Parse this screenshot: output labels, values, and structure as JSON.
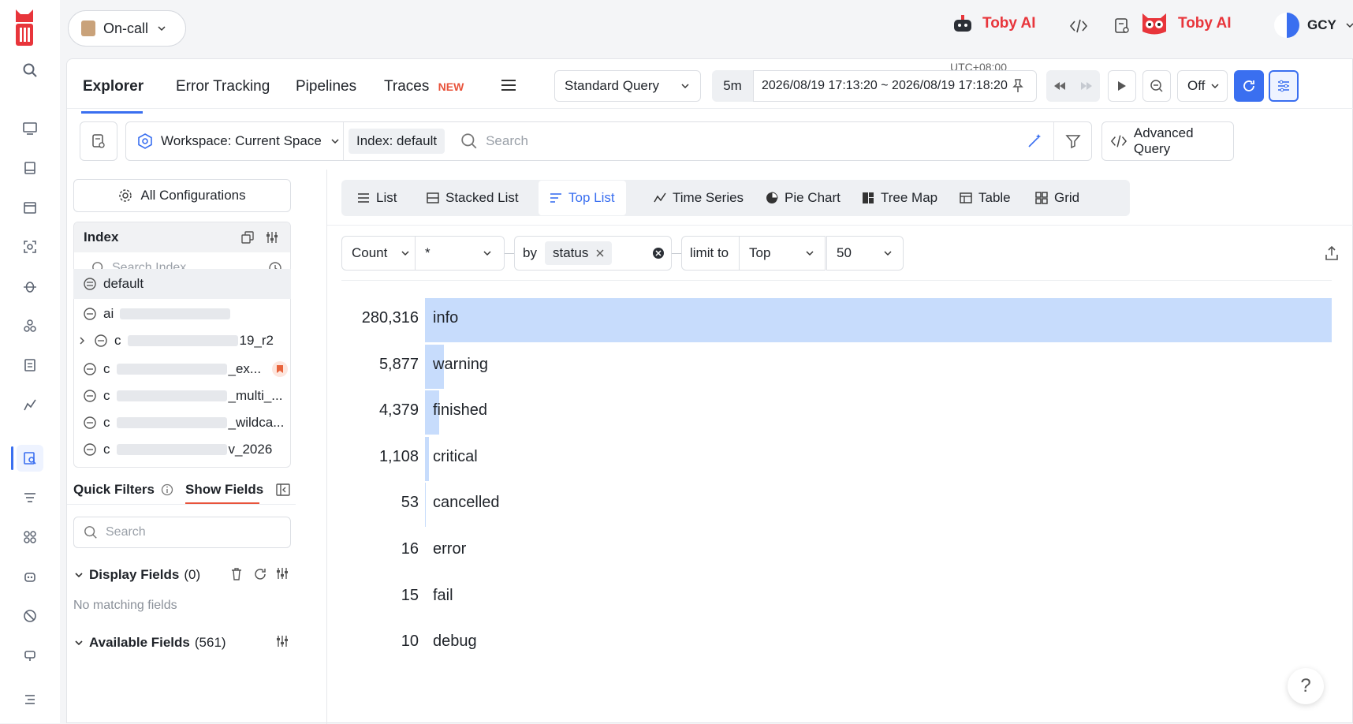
{
  "topbar": {
    "oncall_label": "On-call",
    "toby_ai_1": "Toby AI",
    "toby_ai_2": "Toby AI",
    "user_initials": "GCY"
  },
  "nav": {
    "tabs": [
      {
        "label": "Explorer",
        "active": true
      },
      {
        "label": "Error Tracking",
        "active": false
      },
      {
        "label": "Pipelines",
        "active": false
      },
      {
        "label": "Traces",
        "active": false
      }
    ],
    "traces_badge": "NEW",
    "query_mode": "Standard Query",
    "timezone": "UTC+08:00",
    "time_preset": "5m",
    "time_range": "2026/08/19 17:13:20 ~ 2026/08/19 17:18:20",
    "refresh_mode": "Off"
  },
  "searchbar": {
    "workspace": "Workspace: Current Space",
    "index_chip": "Index: default",
    "search_placeholder": "Search",
    "advanced_query": "Advanced Query"
  },
  "left_panel": {
    "all_configurations": "All Configurations",
    "index_header": "Index",
    "search_index_placeholder": "Search Index",
    "indexes": [
      {
        "prefix": "default",
        "suffix": ""
      },
      {
        "prefix": "ai",
        "suffix": ""
      },
      {
        "prefix": "c",
        "suffix": "19_r2"
      },
      {
        "prefix": "c",
        "suffix": "_ex..."
      },
      {
        "prefix": "c",
        "suffix": "_multi_..."
      },
      {
        "prefix": "c",
        "suffix": "_wildca..."
      },
      {
        "prefix": "c",
        "suffix": "v_2026"
      }
    ],
    "quick_filters": "Quick Filters",
    "show_fields": "Show Fields",
    "field_search_placeholder": "Search",
    "display_fields": "Display Fields",
    "display_fields_count": "(0)",
    "no_matching": "No matching fields",
    "available_fields": "Available Fields",
    "available_fields_count": "(561)"
  },
  "viz_tabs": [
    "List",
    "Stacked List",
    "Top List",
    "Time Series",
    "Pie Chart",
    "Tree Map",
    "Table",
    "Grid"
  ],
  "viz_active": "Top List",
  "query_builder": {
    "aggregate": "Count",
    "field": "*",
    "by_label": "by",
    "group_by": "status",
    "limit_label": "limit to",
    "limit_order": "Top",
    "limit_value": "50"
  },
  "chart_data": {
    "type": "bar",
    "categories": [
      "info",
      "warning",
      "finished",
      "critical",
      "cancelled",
      "error",
      "fail",
      "debug"
    ],
    "values": [
      280316,
      5877,
      4379,
      1108,
      53,
      16,
      15,
      10
    ],
    "value_labels": [
      "280,316",
      "5,877",
      "4,379",
      "1,108",
      "53",
      "16",
      "15",
      "10"
    ],
    "bar_color": "#c7dcfc"
  },
  "help_label": "?"
}
